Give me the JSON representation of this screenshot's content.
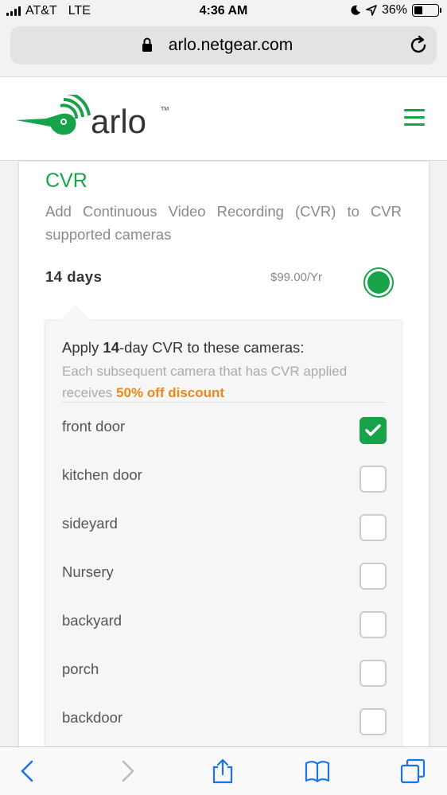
{
  "status_bar": {
    "carrier": "AT&T",
    "network": "LTE",
    "time": "4:36 AM",
    "battery": "36%",
    "battery_level": 0.36
  },
  "browser": {
    "url": "arlo.netgear.com"
  },
  "header": {
    "logo_text": "arlo",
    "brand_color": "#17a34a"
  },
  "cvr": {
    "title": "CVR",
    "description": "Add Continuous Video Recording (CVR) to CVR supported cameras",
    "plan": {
      "days": "14 days",
      "price": "$99.00/Yr",
      "selected": true
    }
  },
  "apply_popup": {
    "title_prefix": "Apply ",
    "title_bold": "14",
    "title_suffix": "-day CVR to these cameras:",
    "note_prefix": "Each subsequent camera that has CVR applied receives ",
    "note_highlight": "50% off discount",
    "highlight_color": "#e8891a",
    "cameras": [
      {
        "name": "front door",
        "checked": true
      },
      {
        "name": "kitchen door",
        "checked": false
      },
      {
        "name": "sideyard",
        "checked": false
      },
      {
        "name": "Nursery",
        "checked": false
      },
      {
        "name": "backyard",
        "checked": false
      },
      {
        "name": "porch",
        "checked": false
      },
      {
        "name": "backdoor",
        "checked": false
      }
    ]
  },
  "toolbar": {
    "icons": [
      "back-icon",
      "forward-icon",
      "share-icon",
      "bookmarks-icon",
      "tabs-icon"
    ]
  }
}
